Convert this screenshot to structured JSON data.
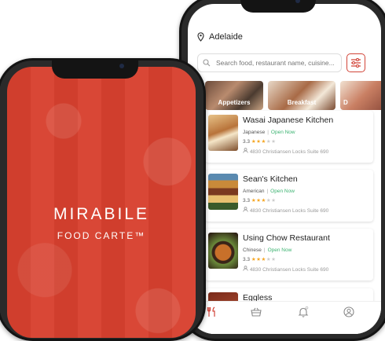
{
  "app_name": "MIRABILE",
  "app_tagline": "FOOD CARTE™",
  "location": "Adelaide",
  "search": {
    "placeholder": "Search food, restaurant name, cuisine..."
  },
  "categories": [
    "Appetizers",
    "Breakfast",
    "D"
  ],
  "restaurants": [
    {
      "name": "Wasai Japanese Kitchen",
      "cuisine": "Japanese",
      "status": "Open Now",
      "rating": "3.3",
      "stars": 3,
      "address": "4830 Christiansen Locks Suite 690"
    },
    {
      "name": "Sean's Kitchen",
      "cuisine": "American",
      "status": "Open Now",
      "rating": "3.3",
      "stars": 3,
      "address": "4830 Christiansen Locks Suite 690"
    },
    {
      "name": "Using Chow Restaurant",
      "cuisine": "Chinese",
      "status": "Open Now",
      "rating": "3.3",
      "stars": 3,
      "address": "4830 Christiansen Locks Suite 690"
    },
    {
      "name": "Eggless"
    }
  ],
  "nav": [
    "restaurant-icon",
    "basket-icon",
    "bell-icon",
    "profile-icon"
  ],
  "colors": {
    "brand": "#d8412f",
    "accent": "#d24438",
    "open": "#3cb371",
    "star": "#f5a623"
  }
}
